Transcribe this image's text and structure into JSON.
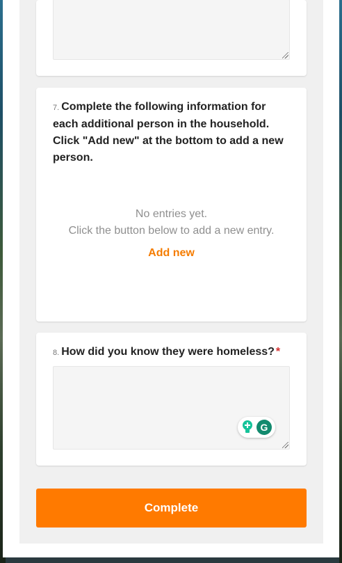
{
  "questions": [
    {
      "number": "7.",
      "text": "Complete the following information for each additional person in the household. Click \"Add new\" at the bottom to add a new person.",
      "empty_line1": "No entries yet.",
      "empty_line2": "Click the button below to add a new entry.",
      "add_label": "Add new"
    },
    {
      "number": "8.",
      "text": "How did you know they were homeless?",
      "required_mark": "*",
      "answer": ""
    }
  ],
  "complete_label": "Complete",
  "icons": {
    "grammarly_tip": "lightbulb-plus-icon",
    "grammarly_logo": "grammarly-icon",
    "grammarly_letter": "G"
  },
  "colors": {
    "accent": "#ff7a00",
    "link": "#f57c00",
    "required": "#d32f2f"
  }
}
